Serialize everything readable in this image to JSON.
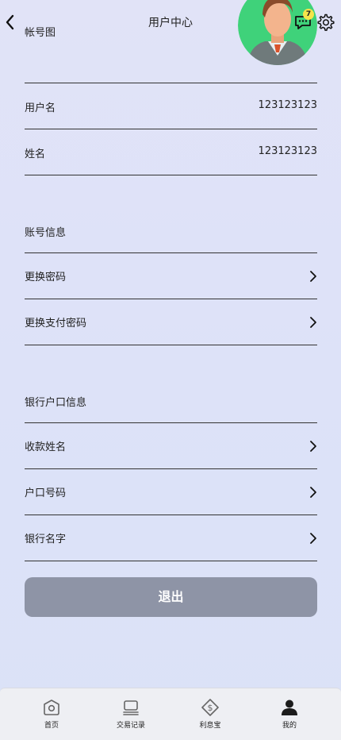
{
  "header": {
    "title": "用户中心",
    "account_avatar_label": "帐号图",
    "message_badge_count": "7"
  },
  "profile": {
    "username_label": "用户名",
    "username_value": "123123123",
    "name_label": "姓名",
    "name_value": "123123123"
  },
  "account_section": {
    "title": "账号信息",
    "items": [
      {
        "label": "更换密码"
      },
      {
        "label": "更换支付密码"
      }
    ]
  },
  "bank_section": {
    "title": "银行户口信息",
    "items": [
      {
        "label": "收款姓名"
      },
      {
        "label": "户口号码"
      },
      {
        "label": "银行名字"
      }
    ]
  },
  "logout_label": "退出",
  "tabbar": {
    "items": [
      {
        "label": "首页",
        "icon": "home-icon"
      },
      {
        "label": "交易记录",
        "icon": "records-icon"
      },
      {
        "label": "利息宝",
        "icon": "interest-icon"
      },
      {
        "label": "我的",
        "icon": "profile-icon"
      }
    ]
  },
  "colors": {
    "background": "#dde2f8",
    "logout_button": "#8e94a6",
    "badge": "#f6e44a",
    "avatar_bg": "#3fd27a"
  }
}
